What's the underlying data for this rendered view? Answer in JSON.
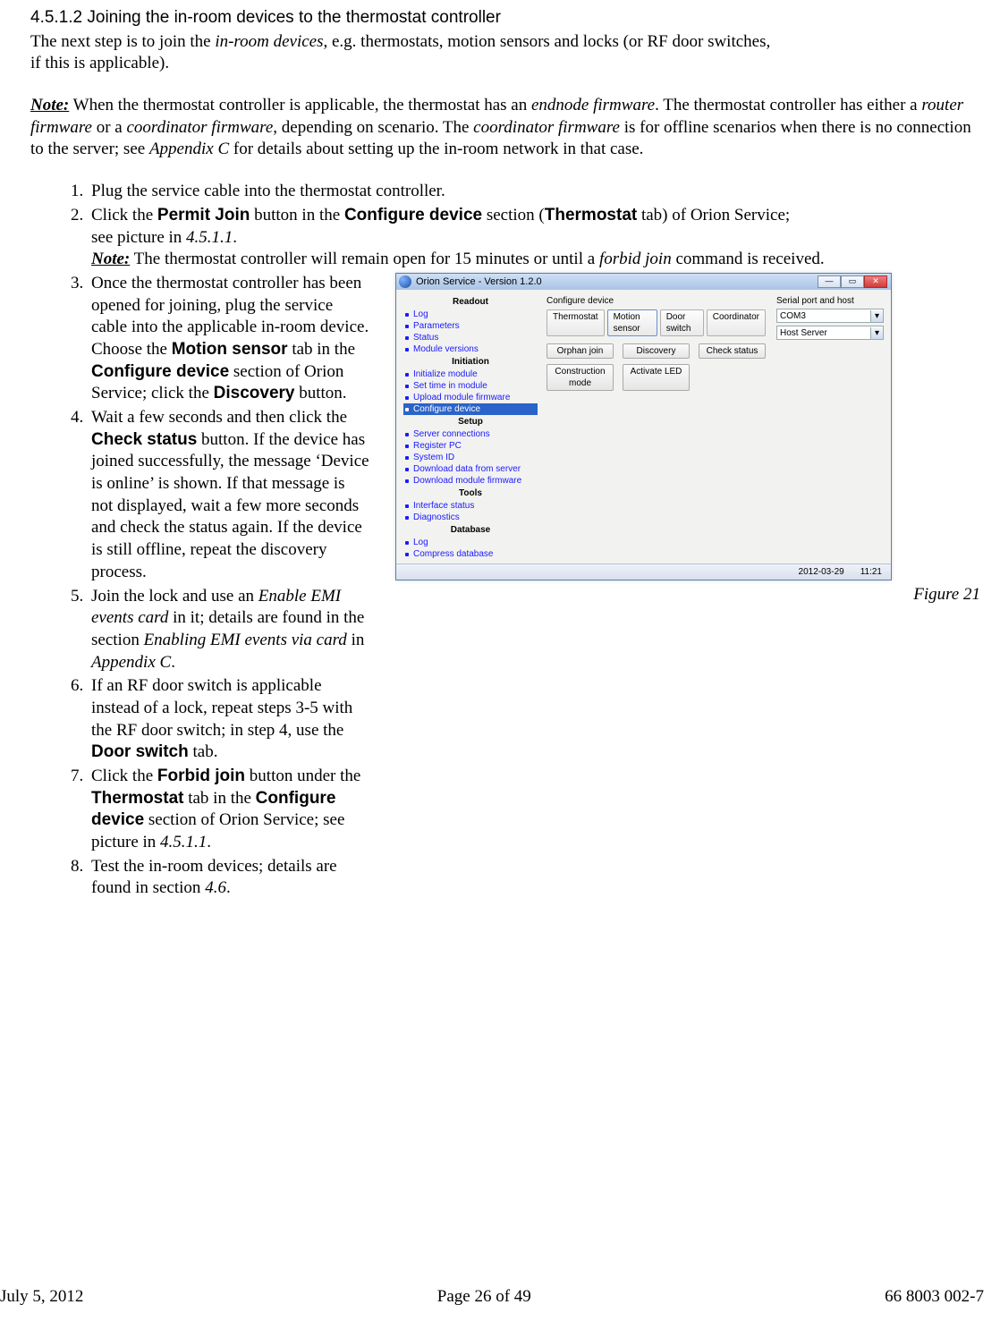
{
  "heading": "4.5.1.2 Joining the in-room devices to the thermostat controller",
  "intro": {
    "p1_a": "The next step is to join the ",
    "p1_b": "in-room devices",
    "p1_c": ", e.g. thermostats, motion sensors and locks (or RF door switches,",
    "p1_d": "if this is applicable)."
  },
  "note": {
    "label": "Note:",
    "a": " When the thermostat controller is applicable, the thermostat has an ",
    "b": "endnode firmware",
    "c": ". The thermostat controller has either a ",
    "d": "router firmware",
    "e": " or a ",
    "f": "coordinator firmware",
    "g": ", depending on scenario. The ",
    "h": "coordinator firmware",
    "i": " is for offline scenarios when there is no connection to the server; see ",
    "j": "Appendix C",
    "k": " for details about setting up the in-room network in that case."
  },
  "steps": {
    "s1": "Plug the service cable into the thermostat controller.",
    "s2": {
      "a": "Click the ",
      "b": "Permit Join",
      "c": " button in the ",
      "d": "Configure device",
      "e": " section (",
      "f": "Thermostat",
      "g": " tab) of Orion Service;",
      "line2a": "see picture in ",
      "line2b": "4.5.1.1",
      "line2c": ".",
      "note_lbl": "Note:",
      "note_a": " The thermostat controller will remain open for 15 minutes or until a ",
      "note_b": "forbid join",
      "note_c": " command is received."
    },
    "s3": {
      "a": "Once the thermostat controller has been opened for joining, plug the service cable into the applicable in-room device. Choose the ",
      "b": "Motion sensor",
      "c": " tab in the ",
      "d": "Configure device",
      "e": " section of Orion Service; click the ",
      "f": "Discovery",
      "g": " button."
    },
    "s4": {
      "a": "Wait a few seconds and then click the ",
      "b": "Check status",
      "c": " button. If the device has joined successfully, the message ‘Device is online’ is shown. If that message is not displayed, wait a few more seconds and check the status again. If the device is still offline, repeat the discovery process."
    },
    "s5": {
      "a": "Join the lock and use an ",
      "b": "Enable EMI events card",
      "c": " in it; details are found in the section ",
      "d": "Enabling EMI events via card",
      "e": " in ",
      "f": "Appendix C",
      "g": "."
    },
    "s6": {
      "a": "If an RF door switch is applicable instead of a lock, repeat steps 3-5 with the RF door switch; in step 4, use the ",
      "b": "Door switch",
      "c": " tab."
    },
    "s7": {
      "a": "Click the ",
      "b": "Forbid join",
      "c": " button under the ",
      "d": "Thermostat",
      "e": " tab in the ",
      "f": "Configure device",
      "g": " section of Orion Service; see picture in ",
      "h": "4.5.1.1",
      "i": "."
    },
    "s8": {
      "a": "Test the in-room devices; details are found in section ",
      "b": "4.6",
      "c": "."
    }
  },
  "window": {
    "title": "Orion Service - Version 1.2.0",
    "configure_label": "Configure device",
    "tabs": [
      "Thermostat",
      "Motion sensor",
      "Door switch",
      "Coordinator"
    ],
    "active_tab_index": 1,
    "buttons": [
      "Orphan join",
      "Discovery",
      "Check status",
      "Construction mode",
      "Activate LED"
    ],
    "serial_label": "Serial port and host",
    "combo1": "COM3",
    "combo2": "Host Server",
    "status_date": "2012-03-29",
    "status_time": "11:21",
    "sidebar": {
      "groups": [
        {
          "title": "Readout",
          "items": [
            "Log",
            "Parameters",
            "Status",
            "Module versions"
          ]
        },
        {
          "title": "Initiation",
          "items": [
            "Initialize module",
            "Set time in module",
            "Upload module firmware",
            "Configure device"
          ],
          "selected": 3
        },
        {
          "title": "Setup",
          "items": [
            "Server connections",
            "Register PC",
            "System ID",
            "Download data from server",
            "Download module firmware"
          ]
        },
        {
          "title": "Tools",
          "items": [
            "Interface status",
            "Diagnostics"
          ]
        },
        {
          "title": "Database",
          "items": [
            "Log",
            "Compress database"
          ]
        }
      ]
    }
  },
  "figure_caption": "Figure 21",
  "footer": {
    "left": "July 5, 2012",
    "center": "Page 26 of 49",
    "right": "66 8003 002-7"
  }
}
